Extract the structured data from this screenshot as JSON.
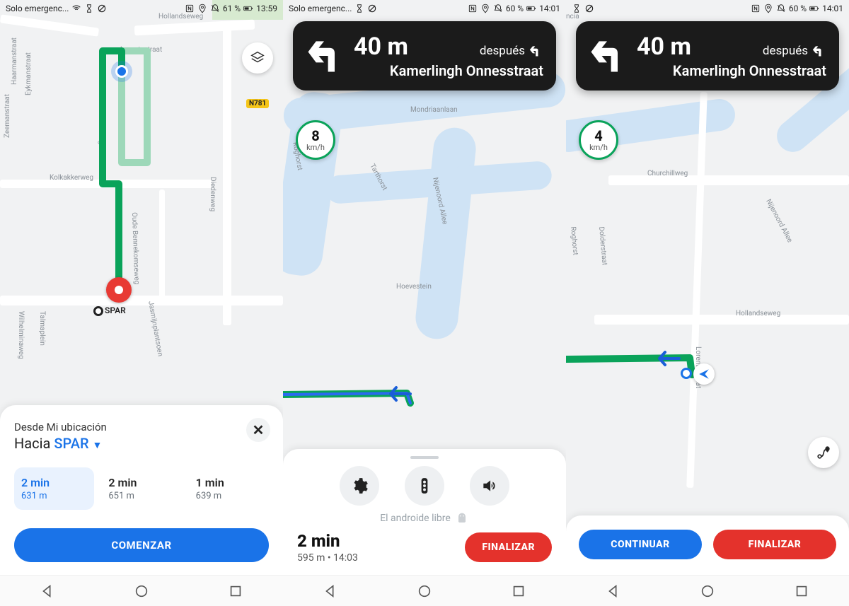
{
  "status": {
    "carrier": "Solo emergenc...",
    "carrier23": "Solo emergenc...",
    "battery1": "61 %",
    "battery2": "60 %",
    "battery3": "60 %",
    "time1": "13:59",
    "time2": "14:01",
    "time3": "14:01"
  },
  "screen1": {
    "roadBadge": "N781",
    "poiName": "SPAR",
    "streets": {
      "a": "Hollandseweg",
      "c": "Kolkakkerweg",
      "d": "Diedenweg",
      "e": "Oude Bennekomseweg",
      "f": "Haarmanstraat",
      "g": "Eykmanstraat",
      "h": "Zeemanstraat",
      "i": "Lorentzstraat",
      "j": "Jasmijnplantsoen",
      "k": "Wilhelminaweg",
      "l": "Talmaplein",
      "m": "Nobelweg"
    },
    "from": "Desde Mi ubicación",
    "toPrefix": "Hacia",
    "toName": "SPAR",
    "close": "✕",
    "options": [
      {
        "time": "2 min",
        "dist": "631 m"
      },
      {
        "time": "2 min",
        "dist": "651 m"
      },
      {
        "time": "1 min",
        "dist": "639 m"
      }
    ],
    "start": "COMENZAR"
  },
  "turn": {
    "distance": "40 m",
    "thenLabel": "después",
    "street": "Kamerlingh Onnesstraat"
  },
  "screen2": {
    "speed": "8",
    "speedUnit": "km/h",
    "streets": {
      "a": "Mondriaanlaan",
      "b": "Tarthorst",
      "c": "Nijenoord Allee",
      "d": "Hoevestein",
      "e": "Roghorst"
    },
    "watermark": "El androide libre",
    "etaTime": "2 min",
    "etaSub": "595 m • 14:03",
    "finalize": "FINALIZAR"
  },
  "screen3": {
    "speed": "4",
    "speedUnit": "km/h",
    "streets": {
      "a": "Churchillweg",
      "b": "Dolderstraat",
      "c": "Nijenoord Allee",
      "d": "Roghorst",
      "e": "Hollandseweg",
      "f": "Lorentzstraat",
      "g": "ncia"
    },
    "continue": "CONTINUAR",
    "finalize": "FINALIZAR"
  }
}
